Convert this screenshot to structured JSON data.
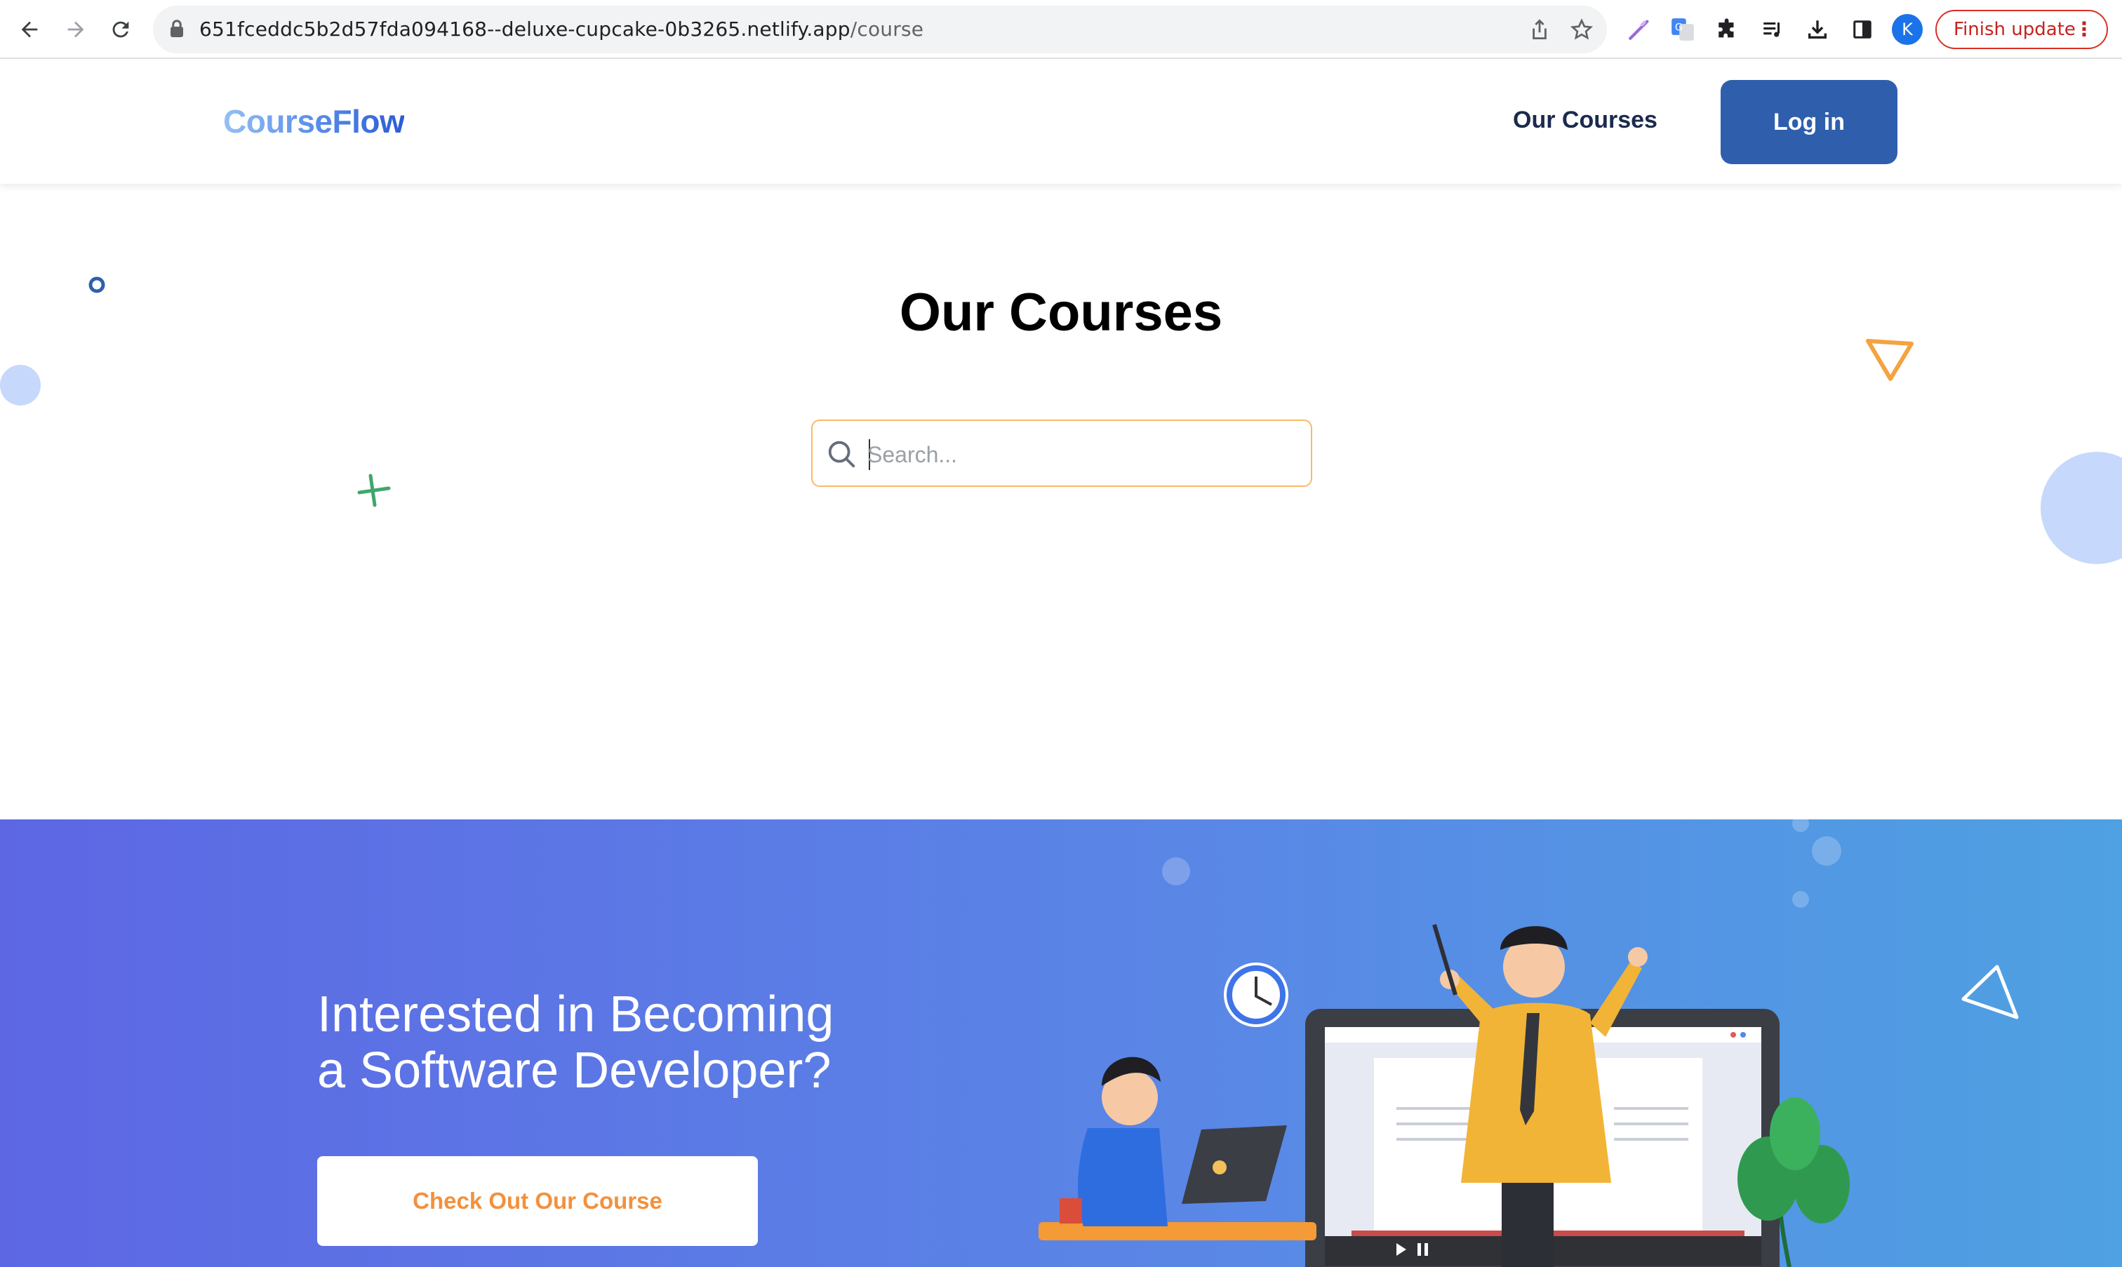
{
  "browser": {
    "url_host": "651fceddc5b2d57fda094168--deluxe-cupcake-0b3265.netlify.app",
    "url_path": "/course",
    "profile_initial": "K",
    "finish_update_label": "Finish update",
    "icons": [
      "back-arrow-icon",
      "forward-arrow-icon",
      "reload-icon",
      "lock-icon",
      "share-icon",
      "star-icon",
      "pen-extension-icon",
      "translate-extension-icon",
      "puzzle-extensions-icon",
      "media-queue-icon",
      "download-icon",
      "side-panel-icon",
      "kebab-menu-icon"
    ]
  },
  "header": {
    "logo": "CourseFlow",
    "nav_courses": "Our Courses",
    "login_label": "Log in"
  },
  "hero": {
    "title": "Our Courses",
    "search_placeholder": "Search...",
    "search_value": ""
  },
  "banner": {
    "heading_line1": "Interested in Becoming",
    "heading_line2": "a Software Developer?",
    "cta_label": "Check Out Our Course"
  },
  "colors": {
    "accent_blue": "#2f5fac",
    "title_navy": "#1b2a4e",
    "search_border": "#f8b968",
    "cta_text": "#f2913d",
    "banner_gradient_start": "#5d67e4",
    "banner_gradient_end": "#4ea1e2"
  }
}
